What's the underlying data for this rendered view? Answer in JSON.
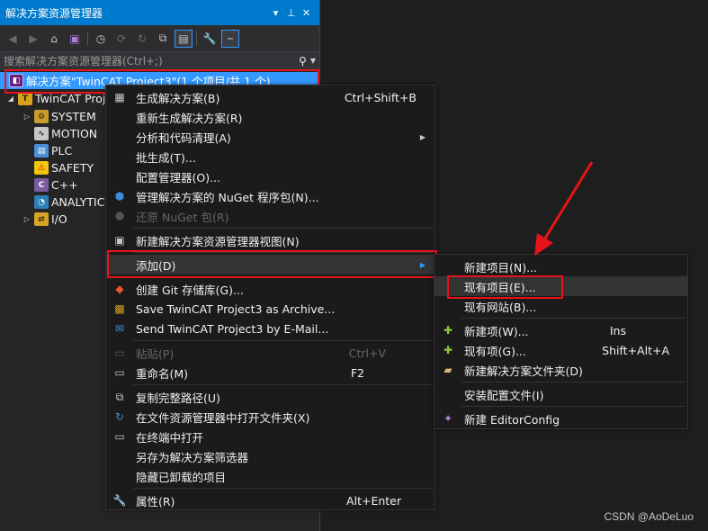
{
  "window": {
    "title": "解决方案资源管理器",
    "controls": [
      "▾",
      "⊥",
      "✕"
    ]
  },
  "search": {
    "placeholder": "搜索解决方案资源管理器(Ctrl+;)"
  },
  "tree": {
    "solution": "解决方案\"TwinCAT Project3\"(1 个项目/共 1 个)",
    "project": "TwinCAT Project3",
    "nodes": [
      "SYSTEM",
      "MOTION",
      "PLC",
      "SAFETY",
      "C++",
      "ANALYTICS",
      "I/O"
    ]
  },
  "context_menu": {
    "items": [
      {
        "label": "生成解决方案(B)",
        "shortcut": "Ctrl+Shift+B",
        "icon": "build-icon"
      },
      {
        "label": "重新生成解决方案(R)",
        "shortcut": ""
      },
      {
        "label": "分析和代码清理(A)",
        "shortcut": "",
        "submenu": true
      },
      {
        "label": "批生成(T)...",
        "shortcut": ""
      },
      {
        "label": "配置管理器(O)...",
        "shortcut": ""
      },
      {
        "label": "管理解决方案的 NuGet 程序包(N)...",
        "shortcut": "",
        "icon": "nuget-icon"
      },
      {
        "label": "还原 NuGet 包(R)",
        "shortcut": "",
        "disabled": true,
        "icon": "restore-icon"
      },
      {
        "label": "新建解决方案资源管理器视图(N)",
        "shortcut": "",
        "icon": "new-view-icon"
      },
      {
        "label": "添加(D)",
        "shortcut": "",
        "submenu": true,
        "highlighted": true
      },
      {
        "label": "创建 Git 存储库(G)...",
        "shortcut": "",
        "icon": "git-icon"
      },
      {
        "label": "Save TwinCAT Project3 as Archive...",
        "shortcut": "",
        "icon": "archive-icon"
      },
      {
        "label": "Send TwinCAT Project3 by E-Mail...",
        "shortcut": "",
        "icon": "email-icon"
      },
      {
        "label": "粘贴(P)",
        "shortcut": "Ctrl+V",
        "disabled": true,
        "icon": "paste-icon"
      },
      {
        "label": "重命名(M)",
        "shortcut": "F2",
        "icon": "rename-icon"
      },
      {
        "label": "复制完整路径(U)",
        "shortcut": "",
        "icon": "copy-icon"
      },
      {
        "label": "在文件资源管理器中打开文件夹(X)",
        "shortcut": "",
        "icon": "refresh-icon"
      },
      {
        "label": "在终端中打开",
        "shortcut": "",
        "icon": "terminal-icon"
      },
      {
        "label": "另存为解决方案筛选器",
        "shortcut": ""
      },
      {
        "label": "隐藏已卸载的项目",
        "shortcut": ""
      },
      {
        "label": "属性(R)",
        "shortcut": "Alt+Enter",
        "icon": "wrench-icon"
      }
    ]
  },
  "submenu": {
    "items": [
      {
        "label": "新建项目(N)...",
        "shortcut": ""
      },
      {
        "label": "现有项目(E)...",
        "shortcut": "",
        "highlighted": true
      },
      {
        "label": "现有网站(B)...",
        "shortcut": ""
      },
      {
        "label": "新建项(W)...",
        "shortcut": "Ins",
        "icon": "new-item-icon"
      },
      {
        "label": "现有项(G)...",
        "shortcut": "Shift+Alt+A",
        "icon": "existing-item-icon"
      },
      {
        "label": "新建解决方案文件夹(D)",
        "shortcut": "",
        "icon": "folder-icon"
      },
      {
        "label": "安装配置文件(I)",
        "shortcut": ""
      },
      {
        "label": "新建 EditorConfig",
        "shortcut": "",
        "icon": "editorconfig-icon"
      }
    ]
  },
  "watermark": "CSDN @AoDeLuo",
  "colors": {
    "accent": "#007acc",
    "selection": "#3399ff",
    "annotation_red": "#e8131a",
    "menu_bg": "#1b1b1c"
  }
}
